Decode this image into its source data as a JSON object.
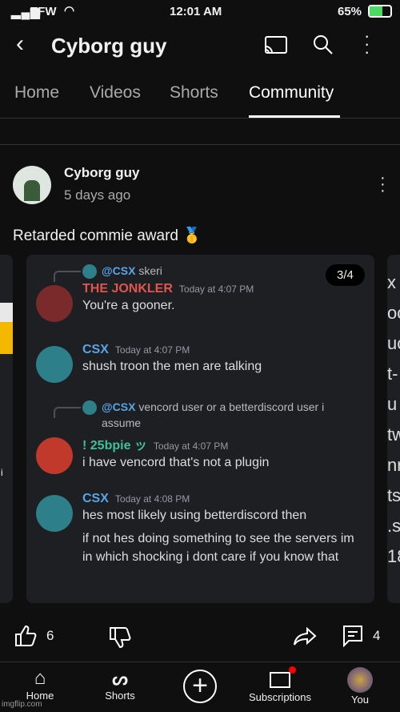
{
  "status_bar": {
    "carrier": "TFW",
    "time": "12:01 AM",
    "battery": "65%"
  },
  "header": {
    "title": "Cyborg guy"
  },
  "tabs": [
    {
      "label": "Home"
    },
    {
      "label": "Videos"
    },
    {
      "label": "Shorts"
    },
    {
      "label": "Community",
      "active": true
    }
  ],
  "post": {
    "author": "Cyborg guy",
    "age": "5 days ago",
    "text": "Retarded commie award 🥇",
    "likes": "6",
    "comments": "4",
    "carousel": {
      "page": "3/4",
      "messages": [
        {
          "reply_to": "@CSX",
          "reply_text": "skeri",
          "name": "THE JONKLER",
          "name_color": "#e0564f",
          "time": "Today at 4:07 PM",
          "lines": [
            "You're a gooner."
          ]
        },
        {
          "name": "CSX",
          "name_color": "#56a6e8",
          "time": "Today at 4:07 PM",
          "lines": [
            "shush troon the men are talking"
          ]
        },
        {
          "reply_to": "@CSX",
          "reply_text": "vencord user or a betterdiscord user i assume",
          "name": "! 25bpie ッ",
          "name_color": "#3fbf9a",
          "time": "Today at 4:07 PM",
          "lines": [
            "i have vencord that's not a plugin"
          ]
        },
        {
          "name": "CSX",
          "name_color": "#56a6e8",
          "time": "Today at 4:08 PM",
          "lines": [
            "hes most likely using betterdiscord then",
            "if not hes doing something to see the servers im in which shocking i dont care if you know that"
          ]
        }
      ]
    },
    "next_peek": [
      "x",
      "oo",
      "uc",
      "t-",
      "u",
      "tw",
      "nr",
      "ts",
      ".s",
      "18"
    ],
    "prev_peek": "i"
  },
  "bottom_nav": [
    {
      "label": "Home",
      "icon": "home-icon"
    },
    {
      "label": "Shorts",
      "icon": "shorts-icon"
    },
    {
      "label": "",
      "icon": "create-icon"
    },
    {
      "label": "Subscriptions",
      "icon": "subscriptions-icon"
    },
    {
      "label": "You",
      "icon": "avatar"
    }
  ],
  "watermark": "imgflip.com"
}
